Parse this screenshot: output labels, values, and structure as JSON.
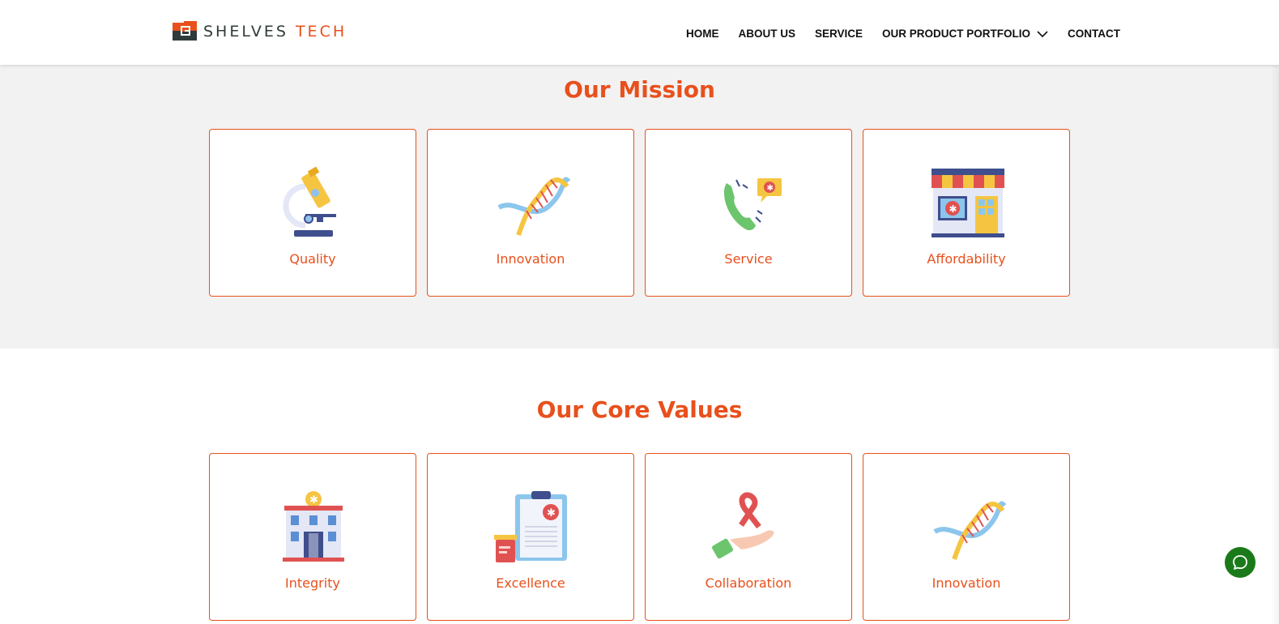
{
  "brand": {
    "name_part1": "SHELVES ",
    "name_part2": "TECH",
    "accent_color": "#e8501c",
    "dark_color": "#2f3b3a"
  },
  "nav": {
    "items": [
      {
        "label": "HOME"
      },
      {
        "label": "ABOUT US"
      },
      {
        "label": "SERVICE"
      },
      {
        "label": "OUR PRODUCT PORTFOLIO",
        "icon": "chevron-down-icon"
      },
      {
        "label": "CONTACT"
      }
    ]
  },
  "mission": {
    "title": "Our Mission",
    "cards": [
      {
        "label": "Quality",
        "icon": "microscope-icon"
      },
      {
        "label": "Innovation",
        "icon": "dna-icon"
      },
      {
        "label": "Service",
        "icon": "phone-call-icon"
      },
      {
        "label": "Affordability",
        "icon": "pharmacy-store-icon"
      }
    ]
  },
  "core_values": {
    "title": "Our Core Values",
    "cards": [
      {
        "label": "Integrity",
        "icon": "hospital-building-icon"
      },
      {
        "label": "Excellence",
        "icon": "medical-clipboard-icon"
      },
      {
        "label": "Collaboration",
        "icon": "ribbon-hand-icon"
      },
      {
        "label": "Innovation",
        "icon": "dna-icon"
      }
    ]
  },
  "chat": {
    "icon": "chat-bubble-icon",
    "color": "#1a7a1a"
  },
  "colors": {
    "section_bg": "#f2f2f2",
    "accent": "#e8501c"
  }
}
